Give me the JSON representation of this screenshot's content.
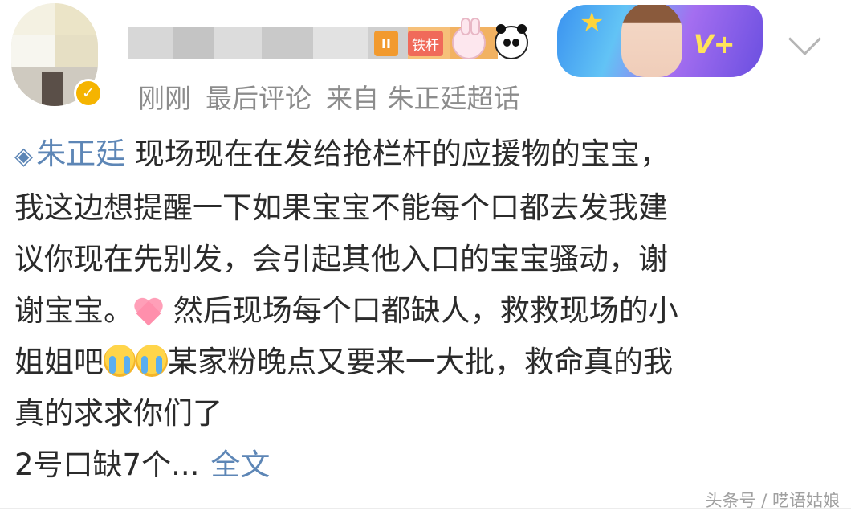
{
  "post": {
    "header": {
      "level_badge": "II",
      "fan_badge": "铁杆",
      "banner_text": "V+",
      "meta_time": "刚刚",
      "meta_last_comment": "最后评论",
      "meta_source": "来自 朱正廷超话"
    },
    "body": {
      "topic": "朱正廷",
      "line1": "现场现在在发给抢栏杆的应援物的宝宝，",
      "line2": "我这边想提醒一下如果宝宝不能每个口都去发我建",
      "line3": "议你现在先别发，会引起其他入口的宝宝骚动，谢",
      "line4a": "谢宝宝。",
      "line4b": "然后现场每个口都缺人，救救现场的小",
      "line5a": "姐姐吧",
      "line5b": "某家粉晚点又要来一大批，救命真的我",
      "line6": "真的求求你们了",
      "line7": "2号口缺7个...",
      "more_link": "全文"
    },
    "icons": {
      "topic": "topic-diamond-icon",
      "verified": "verified-badge-icon",
      "rabbit": "rabbit-badge-icon",
      "panda": "panda-badge-icon",
      "heart": "heart-emoji-icon",
      "cry": "crying-emoji-icon",
      "chevron": "chevron-down-icon"
    },
    "colors": {
      "link": "#5d86b6",
      "meta": "#8c8c8c",
      "text": "#2b2b2b"
    }
  },
  "watermark": "头条号 / 呓语姑娘"
}
